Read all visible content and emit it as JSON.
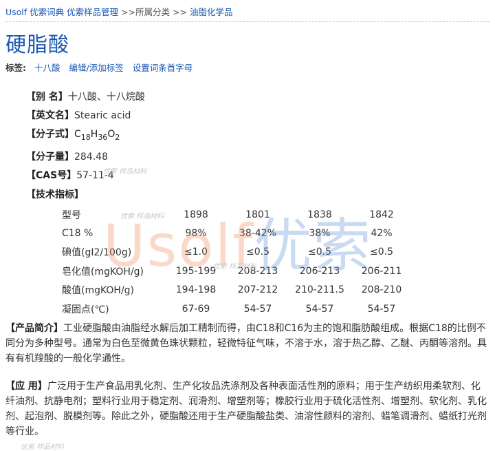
{
  "breadcrumb": {
    "site": "Usolf 优索词典",
    "section": "优索样品管理",
    "mid": ">>所属分类 >>",
    "category": "油脂化学品"
  },
  "title": "硬脂酸",
  "tags": {
    "label": "标签:",
    "tag1": "十八酸",
    "edit": "编辑/添加标签",
    "set_initial": "设置词条首字母"
  },
  "fields": {
    "alias_key": "【别 名】",
    "alias_val": "十八酸、十八烷酸",
    "english_key": "【英文名】",
    "english_val": "Stearic acid",
    "formula_key": "【分子式】",
    "formula": {
      "c": "C",
      "c_n": "18",
      "h": "H",
      "h_n": "36",
      "o": "O",
      "o_n": "2"
    },
    "mw_key": "【分子量】",
    "mw_val": "284.48",
    "cas_key": "【CAS号】",
    "cas_val": "57-11-4"
  },
  "spec": {
    "heading": "【技术指标】",
    "rows": [
      [
        "型号",
        "1898",
        "1801",
        "1838",
        "1842"
      ],
      [
        "C18 %",
        "98%",
        "38-42%",
        "38%",
        "42%"
      ],
      [
        "碘值(gI2/100g)",
        "≤1.0",
        "≤0.5",
        "≤0.5",
        "≤0.5"
      ],
      [
        "皂化值(mgKOH/g)",
        "195-199",
        "208-213",
        "206-213",
        "206-211"
      ],
      [
        "酸值(mgKOH/g)",
        "194-198",
        "207-212",
        "210-211.5",
        "208-210"
      ],
      [
        "凝固点(℃)",
        "67-69",
        "54-57",
        "54-57",
        "54-57"
      ]
    ]
  },
  "intro": {
    "key": "【产品简介】",
    "text": "工业硬脂酸由油脂经水解后加工精制而得，由C18和C16为主的饱和脂肪酸组成。根据C18的比例不同分为多种型号。通常为白色至微黄色珠状颗粒，轻微特征气味，不溶于水，溶于热乙醇、乙醚、丙酮等溶剂。具有有机羧酸的一般化学通性。"
  },
  "usage": {
    "key": "【应 用】",
    "text": "广泛用于生产食品用乳化剂、生产化妆品洗涤剂及各种表面活性剂的原料；用于生产纺织用柔软剂、化纤油剂、抗静电剂；塑料行业用于稳定剂、润滑剂、增塑剂等；橡胶行业用于硫化活性剂、增塑剂、软化剂、乳化剂、起泡剂、脱模剂等。除此之外，硬脂酸还用于生产硬脂酸盐类、油溶性颜料的溶剂、蜡笔调滑剂、蜡纸打光剂等行业。"
  },
  "watermark": {
    "latin": "Usolf",
    "cjk": "优索",
    "stamp": "优索 样品材料"
  },
  "colors": {
    "link": "#1a57b0",
    "watermark_orange": "#f08a5a",
    "watermark_blue": "#5a8fd6"
  }
}
